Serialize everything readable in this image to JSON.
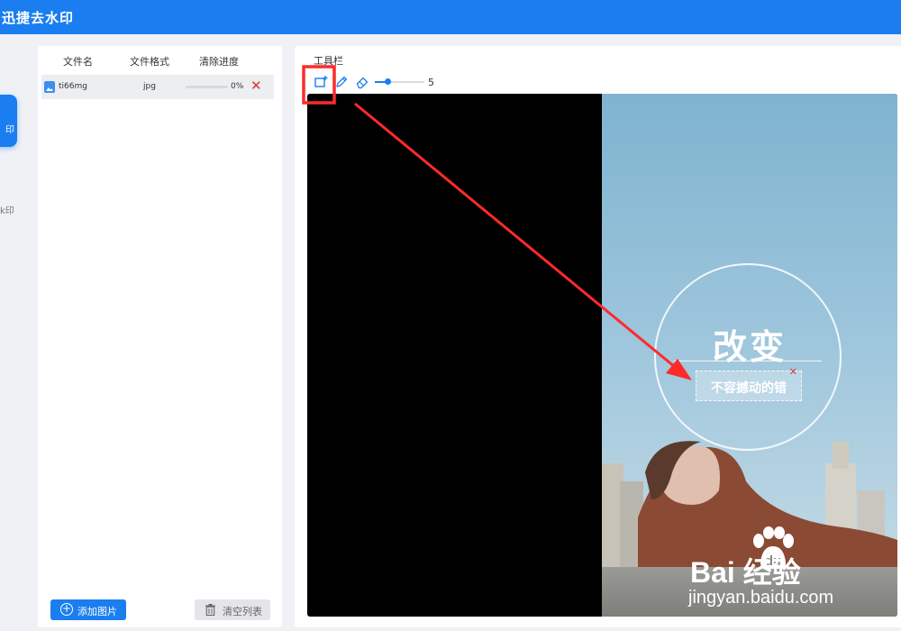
{
  "app": {
    "title": "迅捷去水印"
  },
  "nav": {
    "active_label": "印",
    "item2_label": "k印"
  },
  "file_list": {
    "headers": {
      "name": "文件名",
      "format": "文件格式",
      "progress": "清除进度"
    },
    "rows": [
      {
        "name": "ti66mg",
        "format": "jpg",
        "progress": 0,
        "progress_label": "0%"
      }
    ]
  },
  "buttons": {
    "add_label": "添加图片",
    "clear_label": "清空列表"
  },
  "toolbar": {
    "label": "工具栏",
    "tools": [
      "rect-select-icon",
      "pencil-icon",
      "eraser-icon"
    ],
    "brush_size": 5,
    "brush_size_label": "5",
    "brush_size_range": [
      0,
      20
    ]
  },
  "canvas": {
    "headline": "改变",
    "selected_text": "不容撼动的错",
    "watermark_line1": "Bai  经验",
    "watermark_paw_text": "du",
    "watermark_line2": "jingyan.baidu.com"
  },
  "colors": {
    "accent": "#1a7ef0",
    "danger": "#e0303a",
    "annotation": "#ff2a2a"
  }
}
